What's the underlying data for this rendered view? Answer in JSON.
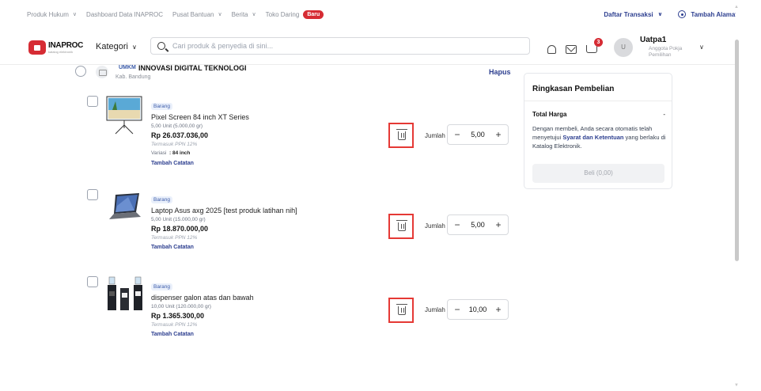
{
  "topnav": {
    "items": [
      {
        "label": "Produk Hukum",
        "has_chevron": true
      },
      {
        "label": "Dashboard Data INAPROC",
        "has_chevron": false
      },
      {
        "label": "Pusat Bantuan",
        "has_chevron": true
      },
      {
        "label": "Berita",
        "has_chevron": true
      },
      {
        "label": "Toko Daring",
        "has_chevron": false
      }
    ],
    "new_badge": "Baru",
    "transactions_label": "Daftar Transaksi",
    "add_address_label": "Tambah Alamat"
  },
  "header": {
    "logo_name": "INAPROC",
    "logo_sub": "katalog elektronik",
    "category_label": "Kategori",
    "search_placeholder": "Cari produk & penyedia di sini...",
    "cart_count": "3",
    "avatar_initial": "U",
    "user_name": "Uatpa1",
    "user_role": "Anggota Pokja Pemilihan"
  },
  "store": {
    "badge": "UMKM",
    "name": "INNOVASI DIGITAL TEKNOLOGI",
    "location": "Kab. Bandung",
    "delete_label": "Hapus"
  },
  "products": [
    {
      "badge": "Barang",
      "name": "Pixel Screen 84 inch XT Series",
      "qty_info": "5,00 Unit (5.000,00 gr)",
      "price": "Rp 26.037.036,00",
      "ppn": "Termasuk PPN 12%",
      "variant_label": "Variasi",
      "variant_value": ": 84 inch",
      "note_label": "Tambah Catatan",
      "jumlah_label": "Jumlah",
      "quantity": "5,00"
    },
    {
      "badge": "Barang",
      "name": "Laptop Asus axg 2025 [test produk latihan nih]",
      "qty_info": "5,00 Unit (15.000,00 gr)",
      "price": "Rp 18.870.000,00",
      "ppn": "Termasuk PPN 12%",
      "note_label": "Tambah Catatan",
      "jumlah_label": "Jumlah",
      "quantity": "5,00"
    },
    {
      "badge": "Barang",
      "name": "dispenser galon atas dan bawah",
      "qty_info": "10,00 Unit (120.000,00 gr)",
      "price": "Rp 1.365.300,00",
      "ppn": "Termasuk PPN 12%",
      "note_label": "Tambah Catatan",
      "jumlah_label": "Jumlah",
      "quantity": "10,00"
    }
  ],
  "stepper": {
    "minus": "−",
    "plus": "+"
  },
  "summary": {
    "title": "Ringkasan Pembelian",
    "total_label": "Total Harga",
    "total_value": "-",
    "agree_prefix": "Dengan membeli, Anda secara otomatis telah menyetujui ",
    "agree_link": "Syarat dan Ketentuan",
    "agree_suffix": " yang berlaku di Katalog Elektronik.",
    "buy_label": "Beli (0,00)"
  },
  "colors": {
    "accent": "#2c3e8f",
    "danger": "#d62c34",
    "highlight": "#e53935"
  }
}
